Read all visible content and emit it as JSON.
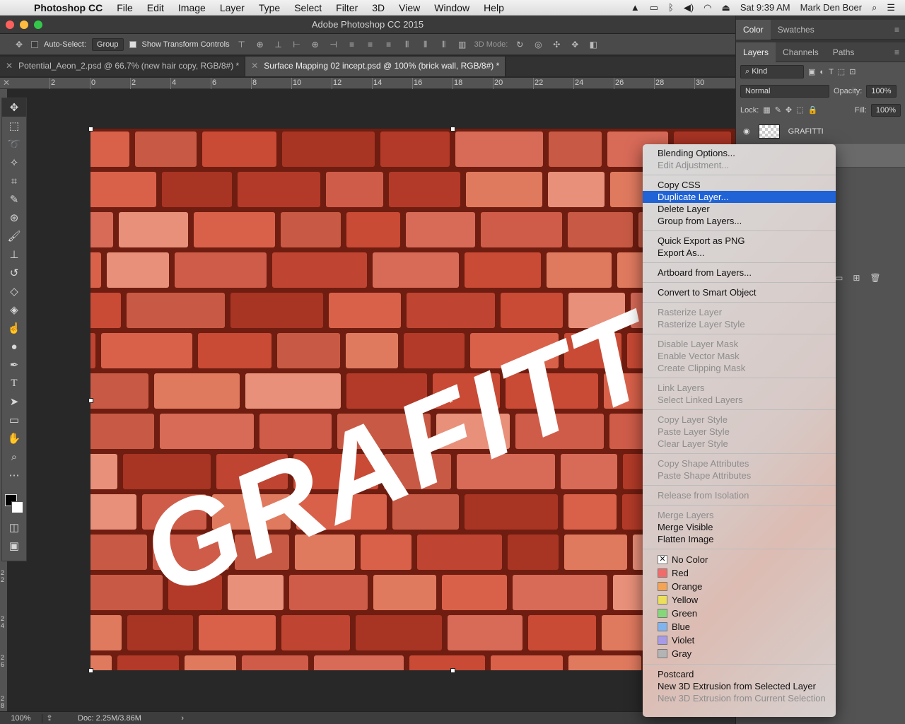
{
  "menubar": {
    "app": "Photoshop CC",
    "items": [
      "File",
      "Edit",
      "Image",
      "Layer",
      "Type",
      "Select",
      "Filter",
      "3D",
      "View",
      "Window",
      "Help"
    ],
    "clock": "Sat 9:39 AM",
    "user": "Mark Den Boer"
  },
  "window": {
    "title": "Adobe Photoshop CC 2015"
  },
  "options": {
    "auto_select": "Auto-Select:",
    "auto_select_value": "Group",
    "show_transform": "Show Transform Controls",
    "mode_3d": "3D Mode:"
  },
  "tabs": [
    {
      "label": "Potential_Aeon_2.psd @ 66.7% (new hair copy, RGB/8#) *"
    },
    {
      "label": "Surface Mapping 02 incept.psd @ 100% (brick wall, RGB/8#) *"
    }
  ],
  "ruler": {
    "top": [
      "2",
      "0",
      "2",
      "4",
      "6",
      "8",
      "10",
      "12",
      "14",
      "16",
      "18",
      "20",
      "22",
      "24",
      "26",
      "28",
      "30"
    ],
    "left": [
      "2",
      "2",
      "2",
      "4",
      "2",
      "6",
      "2",
      "8"
    ]
  },
  "canvas": {
    "text": "GRAFITTI"
  },
  "status": {
    "zoom": "100%",
    "doc": "Doc: 2.25M/3.86M"
  },
  "panels": {
    "top_tabs": [
      "Color",
      "Swatches"
    ],
    "layer_tabs": [
      "Layers",
      "Channels",
      "Paths"
    ],
    "kind": "Kind",
    "blend": "Normal",
    "opacity_label": "Opacity:",
    "opacity": "100%",
    "lock_label": "Lock:",
    "fill_label": "Fill:",
    "fill": "100%",
    "layer_name": "GRAFITTI"
  },
  "context_menu": {
    "groups": [
      [
        {
          "label": "Blending Options...",
          "enabled": true
        },
        {
          "label": "Edit Adjustment...",
          "enabled": false
        }
      ],
      [
        {
          "label": "Copy CSS",
          "enabled": true
        },
        {
          "label": "Duplicate Layer...",
          "enabled": true,
          "highlighted": true
        },
        {
          "label": "Delete Layer",
          "enabled": true
        },
        {
          "label": "Group from Layers...",
          "enabled": true
        }
      ],
      [
        {
          "label": "Quick Export as PNG",
          "enabled": true
        },
        {
          "label": "Export As...",
          "enabled": true
        }
      ],
      [
        {
          "label": "Artboard from Layers...",
          "enabled": true
        }
      ],
      [
        {
          "label": "Convert to Smart Object",
          "enabled": true
        }
      ],
      [
        {
          "label": "Rasterize Layer",
          "enabled": false
        },
        {
          "label": "Rasterize Layer Style",
          "enabled": false
        }
      ],
      [
        {
          "label": "Disable Layer Mask",
          "enabled": false
        },
        {
          "label": "Enable Vector Mask",
          "enabled": false
        },
        {
          "label": "Create Clipping Mask",
          "enabled": false
        }
      ],
      [
        {
          "label": "Link Layers",
          "enabled": false
        },
        {
          "label": "Select Linked Layers",
          "enabled": false
        }
      ],
      [
        {
          "label": "Copy Layer Style",
          "enabled": false
        },
        {
          "label": "Paste Layer Style",
          "enabled": false
        },
        {
          "label": "Clear Layer Style",
          "enabled": false
        }
      ],
      [
        {
          "label": "Copy Shape Attributes",
          "enabled": false
        },
        {
          "label": "Paste Shape Attributes",
          "enabled": false
        }
      ],
      [
        {
          "label": "Release from Isolation",
          "enabled": false
        }
      ],
      [
        {
          "label": "Merge Layers",
          "enabled": false
        },
        {
          "label": "Merge Visible",
          "enabled": true
        },
        {
          "label": "Flatten Image",
          "enabled": true
        }
      ]
    ],
    "colors": [
      {
        "label": "No Color",
        "color": "none"
      },
      {
        "label": "Red",
        "color": "#f26b6b"
      },
      {
        "label": "Orange",
        "color": "#f5a455"
      },
      {
        "label": "Yellow",
        "color": "#ece05a"
      },
      {
        "label": "Green",
        "color": "#86d77a"
      },
      {
        "label": "Blue",
        "color": "#7fb4ee"
      },
      {
        "label": "Violet",
        "color": "#a79ae6"
      },
      {
        "label": "Gray",
        "color": "#b4b4b4"
      }
    ],
    "footer": [
      {
        "label": "Postcard",
        "enabled": true
      },
      {
        "label": "New 3D Extrusion from Selected Layer",
        "enabled": true
      },
      {
        "label": "New 3D Extrusion from Current Selection",
        "enabled": false
      }
    ]
  }
}
